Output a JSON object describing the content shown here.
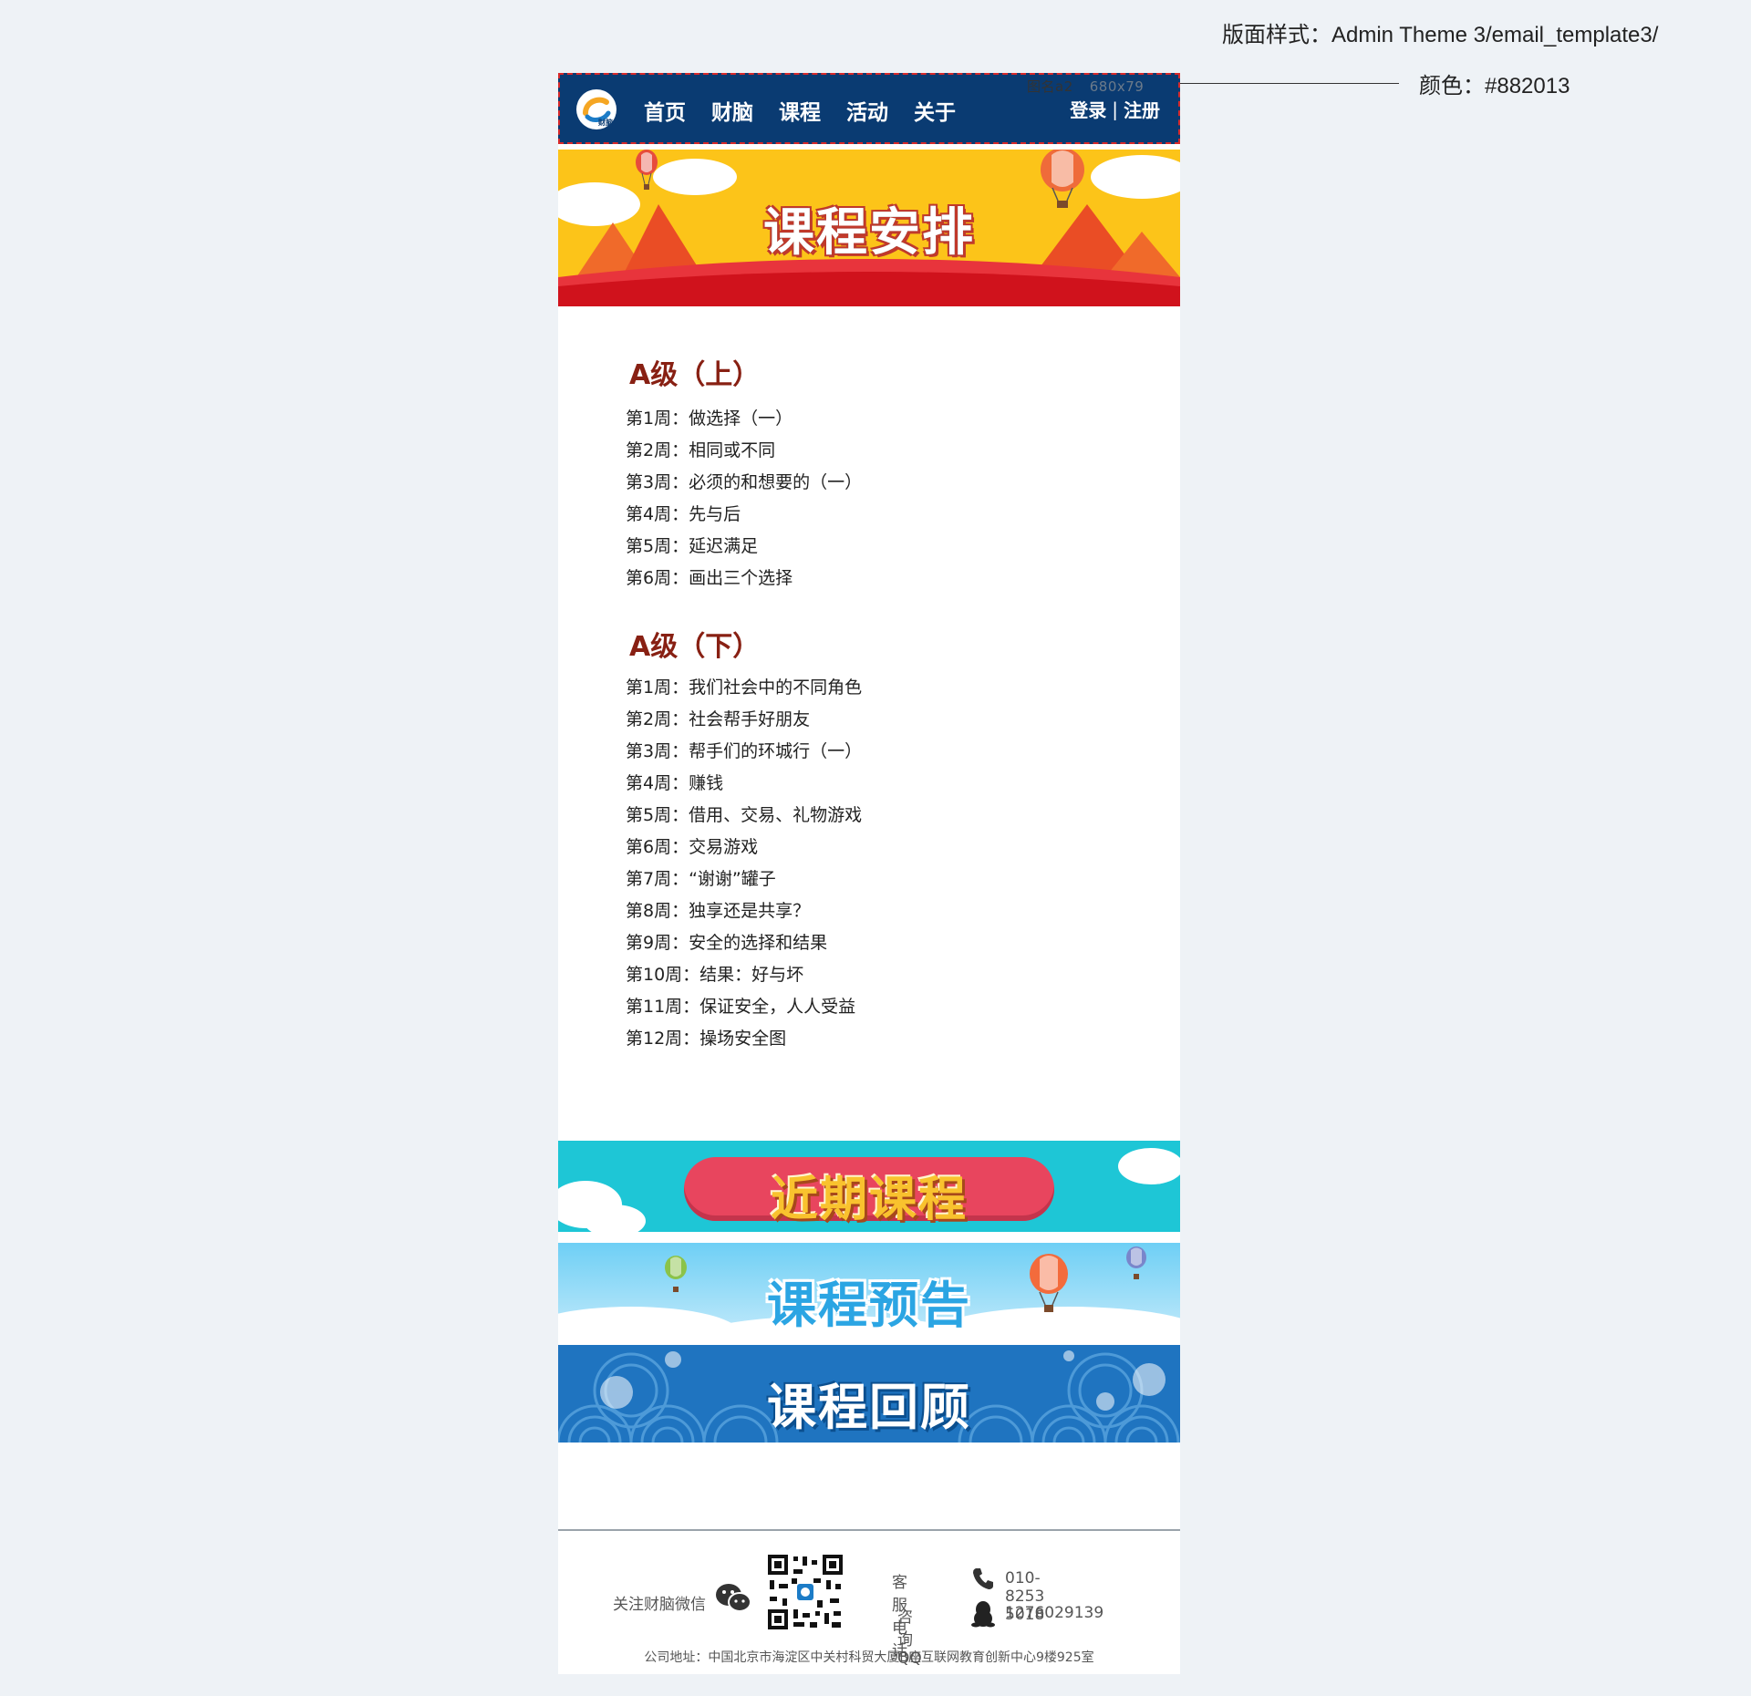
{
  "annotations": {
    "style_note": "版面样式：Admin Theme 3/email_template3/",
    "color_note": "颜色：#882013",
    "header_caption_name": "图名a2",
    "header_caption_size": "680x79"
  },
  "header": {
    "logo_text": "财脑",
    "nav": [
      "首页",
      "财脑",
      "课程",
      "活动",
      "关于"
    ],
    "login": "登录",
    "separator": "|",
    "register": "注册"
  },
  "banners": {
    "schedule": "课程安排",
    "recent": "近期课程",
    "preview": "课程预告",
    "review": "课程回顾"
  },
  "colors": {
    "accent": "#882013",
    "header_bg": "#0a3b72",
    "page_bg": "#eef2f6"
  },
  "sections": [
    {
      "title": "A级（上）",
      "items": [
        "第1周：做选择（一）",
        "第2周：相同或不同",
        "第3周：必须的和想要的（一）",
        "第4周：先与后",
        "第5周：延迟满足",
        "第6周：画出三个选择"
      ]
    },
    {
      "title": "A级（下）",
      "items": [
        "第1周：我们社会中的不同角色",
        "第2周：社会帮手好朋友",
        "第3周：帮手们的环城行（一）",
        "第4周：赚钱",
        "第5周：借用、交易、礼物游戏",
        "第6周：交易游戏",
        "第7周：“谢谢”罐子",
        "第8周：独享还是共享？",
        "第9周：安全的选择和结果",
        "第10周：结果：好与坏",
        "第11周：保证安全，人人受益",
        "第12周：操场安全图"
      ]
    }
  ],
  "footer": {
    "follow_wechat": "关注财脑微信",
    "service_label": "客服电话",
    "service_phone": "010-8253 5018",
    "qq_label": "咨询QQ",
    "qq_number": "1276029139",
    "address": "公司地址：中国北京市海淀区中关村科贸大厦B座互联网教育创新中心9楼925室"
  },
  "icons": [
    "logo-icon",
    "balloon-icon",
    "wechat-icon",
    "qr-code-icon",
    "phone-icon",
    "qq-penguin-icon"
  ]
}
